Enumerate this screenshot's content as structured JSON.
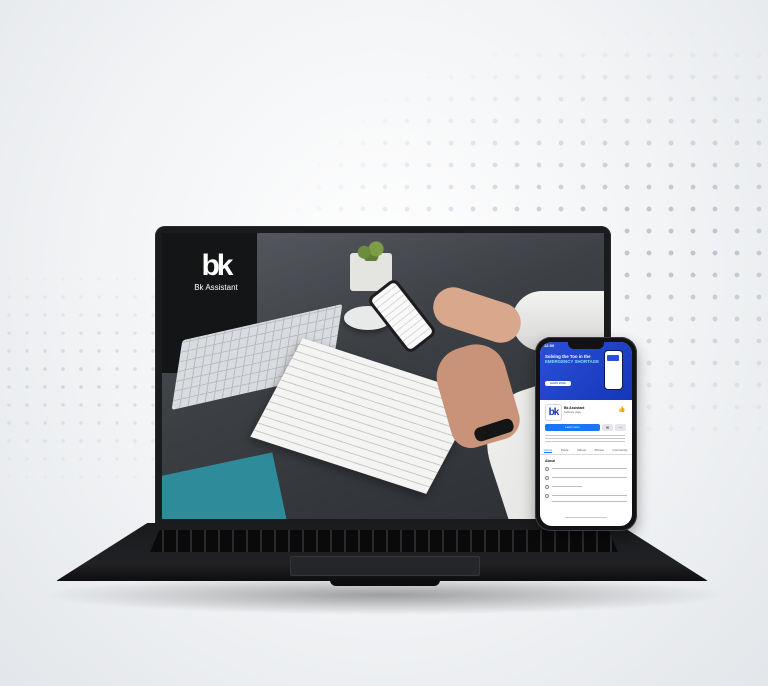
{
  "brand": {
    "mark": "bk",
    "name": "Bk Assistant"
  },
  "phone": {
    "status_time": "12:00",
    "cover_title_line1": "Solving the Too in the",
    "cover_title_highlight": "EMERGENCY SHORTAGE",
    "cover_button": "LEARN MORE",
    "avatar_mark": "bk",
    "page_name": "Bk Assistant",
    "page_category": "Software page",
    "learn_more_label": "Learn more",
    "tabs": [
      "Home",
      "Posts",
      "Videos",
      "Photos",
      "Community"
    ],
    "active_tab": "Home",
    "about_heading": "About"
  },
  "colors": {
    "facebook_blue": "#1877f2",
    "cover_blue": "#1437b8",
    "highlight_cyan": "#7fe0ff"
  }
}
